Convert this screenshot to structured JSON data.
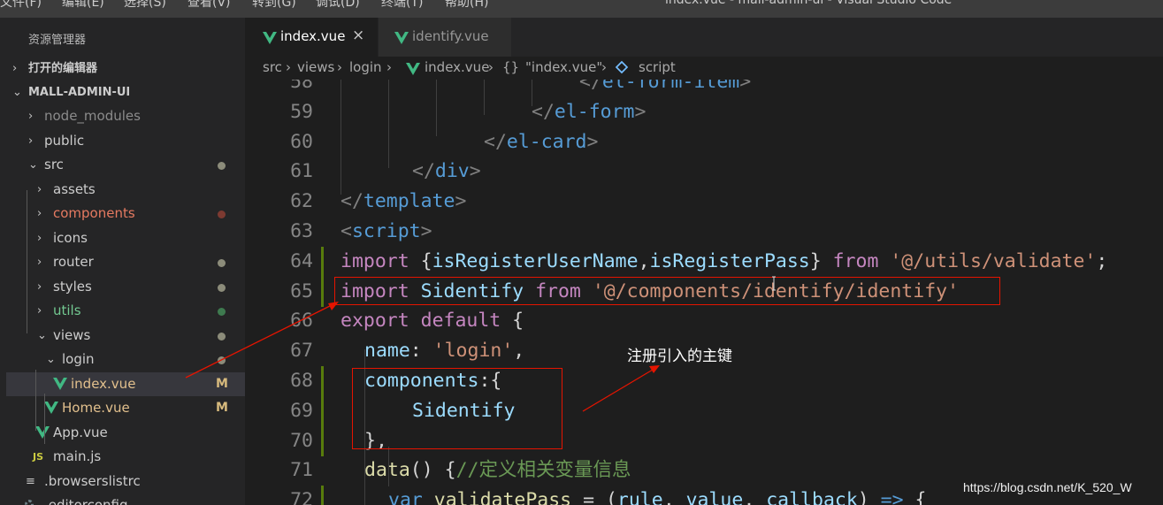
{
  "menubar": {
    "items": [
      "文件(F)",
      "编辑(E)",
      "选择(S)",
      "查看(V)",
      "转到(G)",
      "调试(D)",
      "终端(T)",
      "帮助(H)"
    ],
    "window_title": "index.vue - mall-admin-ui - Visual Studio Code"
  },
  "sidebar": {
    "title": "资源管理器",
    "sections": {
      "open_editors": "打开的编辑器",
      "project": "MALL-ADMIN-UI"
    },
    "tree": [
      {
        "label": "node_modules",
        "color": "#8b8b8b"
      },
      {
        "label": "public",
        "color": "#cccccc"
      },
      {
        "label": "src",
        "color": "#cccccc",
        "status": "#8c8c7a"
      },
      {
        "label": "assets",
        "color": "#cccccc"
      },
      {
        "label": "components",
        "color": "#e57a61",
        "status": "#7d3a31"
      },
      {
        "label": "icons",
        "color": "#cccccc"
      },
      {
        "label": "router",
        "color": "#cccccc",
        "status": "#8c8c7a"
      },
      {
        "label": "styles",
        "color": "#cccccc",
        "status": "#8c8c7a"
      },
      {
        "label": "utils",
        "color": "#73c991",
        "status": "#3e7a4f"
      },
      {
        "label": "views",
        "color": "#cccccc",
        "status": "#8c8c7a"
      },
      {
        "label": "login",
        "color": "#cccccc",
        "status": "#8c8c7a"
      },
      {
        "label": "index.vue",
        "color": "#e2c08d",
        "badge": "M",
        "icon": "vue-icon"
      },
      {
        "label": "Home.vue",
        "color": "#e2c08d",
        "badge": "M",
        "icon": "vue-icon"
      },
      {
        "label": "App.vue",
        "color": "#cccccc",
        "icon": "vue-icon"
      },
      {
        "label": "main.js",
        "color": "#cccccc",
        "icon": "js-icon"
      },
      {
        "label": ".browserslistrc",
        "color": "#cccccc",
        "icon": "file-icon"
      },
      {
        "label": ".editorconfig",
        "color": "#cccccc",
        "icon": "gear-icon"
      }
    ]
  },
  "tabs": [
    {
      "label": "index.vue",
      "active": true,
      "close": "×"
    },
    {
      "label": "identify.vue",
      "active": false
    }
  ],
  "breadcrumb": [
    "src",
    "views",
    "login",
    "index.vue",
    "{}",
    "\"index.vue\"",
    "script"
  ],
  "editor": {
    "lines": [
      {
        "n": "58",
        "indent": 10,
        "tokens": [
          [
            "t-br",
            "</"
          ],
          [
            "t-tag",
            "el-form-item"
          ],
          [
            "t-br",
            ">"
          ]
        ]
      },
      {
        "n": "59",
        "indent": 8,
        "tokens": [
          [
            "t-br",
            "</"
          ],
          [
            "t-tag",
            "el-form"
          ],
          [
            "t-br",
            ">"
          ]
        ]
      },
      {
        "n": "60",
        "indent": 6,
        "tokens": [
          [
            "t-br",
            "</"
          ],
          [
            "t-tag",
            "el-card"
          ],
          [
            "t-br",
            ">"
          ]
        ]
      },
      {
        "n": "61",
        "indent": 3,
        "tokens": [
          [
            "t-br",
            "</"
          ],
          [
            "t-tag",
            "div"
          ],
          [
            "t-br",
            ">"
          ]
        ]
      },
      {
        "n": "62",
        "indent": 0,
        "tokens": [
          [
            "t-br",
            "</"
          ],
          [
            "t-tag",
            "template"
          ],
          [
            "t-br",
            ">"
          ]
        ]
      },
      {
        "n": "63",
        "indent": 0,
        "tokens": [
          [
            "t-br",
            "<"
          ],
          [
            "t-tag",
            "script"
          ],
          [
            "t-br",
            ">"
          ]
        ]
      },
      {
        "n": "64",
        "indent": 0,
        "mark": true,
        "tokens": [
          [
            "t-kw",
            "import"
          ],
          [
            "t-pl",
            " {"
          ],
          [
            "t-var",
            "isRegisterUserName"
          ],
          [
            "t-pl",
            ","
          ],
          [
            "t-var",
            "isRegisterPass"
          ],
          [
            "t-pl",
            "} "
          ],
          [
            "t-kw",
            "from"
          ],
          [
            "t-pl",
            " "
          ],
          [
            "t-str",
            "'@/utils/validate'"
          ],
          [
            "t-pl",
            ";"
          ]
        ]
      },
      {
        "n": "65",
        "indent": 0,
        "mark": true,
        "tokens": [
          [
            "t-kw",
            "import"
          ],
          [
            "t-pl",
            " "
          ],
          [
            "t-var",
            "Sidentify"
          ],
          [
            "t-pl",
            " "
          ],
          [
            "t-kw",
            "from"
          ],
          [
            "t-pl",
            " "
          ],
          [
            "t-str",
            "'@/components/identify/identify'"
          ]
        ]
      },
      {
        "n": "66",
        "indent": 0,
        "tokens": [
          [
            "t-kw",
            "export"
          ],
          [
            "t-pl",
            " "
          ],
          [
            "t-kw",
            "default"
          ],
          [
            "t-pl",
            " {"
          ]
        ]
      },
      {
        "n": "67",
        "indent": 1,
        "tokens": [
          [
            "t-var",
            "name"
          ],
          [
            "t-pl",
            ": "
          ],
          [
            "t-str",
            "'login'"
          ],
          [
            "t-pl",
            ","
          ]
        ]
      },
      {
        "n": "68",
        "indent": 1,
        "mark": true,
        "tokens": [
          [
            "t-var",
            "components"
          ],
          [
            "t-pl",
            ":{"
          ]
        ]
      },
      {
        "n": "69",
        "indent": 3,
        "mark": true,
        "tokens": [
          [
            "t-var",
            "Sidentify"
          ]
        ]
      },
      {
        "n": "70",
        "indent": 1,
        "mark": true,
        "tokens": [
          [
            "t-pl",
            "},"
          ]
        ]
      },
      {
        "n": "71",
        "indent": 1,
        "tokens": [
          [
            "t-fn",
            "data"
          ],
          [
            "t-pl",
            "() {"
          ],
          [
            "t-com",
            "//定义相关变量信息"
          ]
        ]
      },
      {
        "n": "72",
        "indent": 2,
        "mark": true,
        "tokens": [
          [
            "t-blue",
            "var"
          ],
          [
            "t-pl",
            " "
          ],
          [
            "t-fn",
            "validatePass"
          ],
          [
            "t-pl",
            " = ("
          ],
          [
            "t-var",
            "rule"
          ],
          [
            "t-pl",
            ", "
          ],
          [
            "t-var",
            "value"
          ],
          [
            "t-pl",
            ", "
          ],
          [
            "t-var",
            "callback"
          ],
          [
            "t-pl",
            ") "
          ],
          [
            "t-blue",
            "=>"
          ],
          [
            "t-pl",
            " {"
          ]
        ]
      }
    ]
  },
  "annotation": {
    "text": "注册引入的主键",
    "color": "#e51400"
  },
  "watermark": "https://blog.csdn.net/K_520_W",
  "colors": {
    "vue": "#41b883",
    "modified": "#e2c08d",
    "accent": "#e51400"
  }
}
